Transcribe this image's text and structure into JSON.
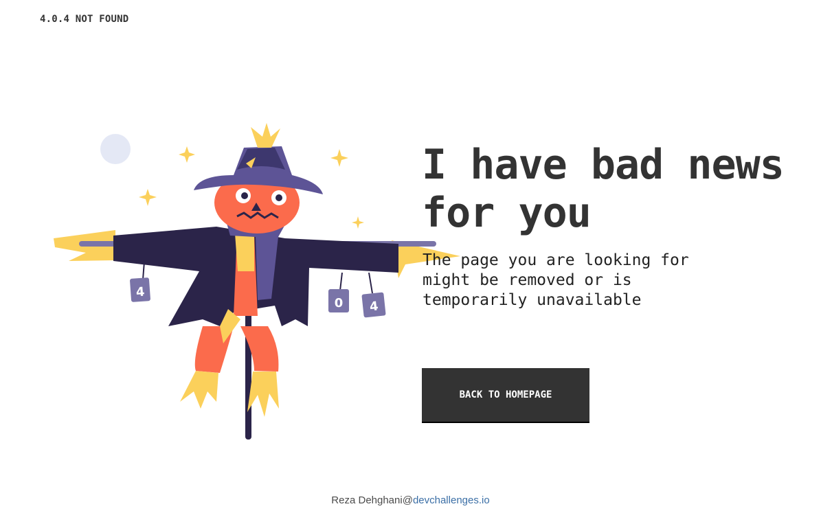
{
  "header": {
    "brand": "4.0.4 NOT FOUND"
  },
  "main": {
    "headline": "I have bad news for you",
    "subtext": "The page you are looking for might be removed or is temporarily unavailable",
    "button_label": "BACK TO HOMEPAGE"
  },
  "illustration": {
    "can_labels": [
      "4",
      "0",
      "4"
    ]
  },
  "footer": {
    "author": "Reza Dehghani",
    "at": "@",
    "link_text": "devchallenges.io"
  },
  "colors": {
    "text": "#333333",
    "button_bg": "#333333",
    "button_text": "#ffffff",
    "link": "#3b6fa6",
    "scarecrow_coat": "#2b2449",
    "scarecrow_hat": "#5d5496",
    "scarecrow_face": "#fb6b4c",
    "straw": "#fbd05b"
  }
}
